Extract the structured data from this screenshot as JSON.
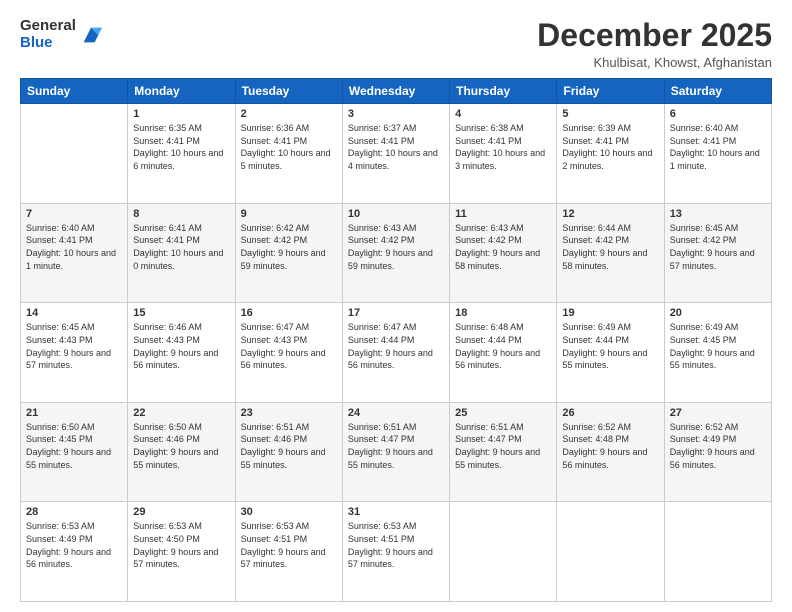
{
  "header": {
    "logo_general": "General",
    "logo_blue": "Blue",
    "month_title": "December 2025",
    "location": "Khulbisat, Khowst, Afghanistan"
  },
  "days_of_week": [
    "Sunday",
    "Monday",
    "Tuesday",
    "Wednesday",
    "Thursday",
    "Friday",
    "Saturday"
  ],
  "weeks": [
    [
      {
        "day": "",
        "sunrise": "",
        "sunset": "",
        "daylight": "",
        "empty": true
      },
      {
        "day": "1",
        "sunrise": "Sunrise: 6:35 AM",
        "sunset": "Sunset: 4:41 PM",
        "daylight": "Daylight: 10 hours and 6 minutes."
      },
      {
        "day": "2",
        "sunrise": "Sunrise: 6:36 AM",
        "sunset": "Sunset: 4:41 PM",
        "daylight": "Daylight: 10 hours and 5 minutes."
      },
      {
        "day": "3",
        "sunrise": "Sunrise: 6:37 AM",
        "sunset": "Sunset: 4:41 PM",
        "daylight": "Daylight: 10 hours and 4 minutes."
      },
      {
        "day": "4",
        "sunrise": "Sunrise: 6:38 AM",
        "sunset": "Sunset: 4:41 PM",
        "daylight": "Daylight: 10 hours and 3 minutes."
      },
      {
        "day": "5",
        "sunrise": "Sunrise: 6:39 AM",
        "sunset": "Sunset: 4:41 PM",
        "daylight": "Daylight: 10 hours and 2 minutes."
      },
      {
        "day": "6",
        "sunrise": "Sunrise: 6:40 AM",
        "sunset": "Sunset: 4:41 PM",
        "daylight": "Daylight: 10 hours and 1 minute."
      }
    ],
    [
      {
        "day": "7",
        "sunrise": "Sunrise: 6:40 AM",
        "sunset": "Sunset: 4:41 PM",
        "daylight": "Daylight: 10 hours and 1 minute."
      },
      {
        "day": "8",
        "sunrise": "Sunrise: 6:41 AM",
        "sunset": "Sunset: 4:41 PM",
        "daylight": "Daylight: 10 hours and 0 minutes."
      },
      {
        "day": "9",
        "sunrise": "Sunrise: 6:42 AM",
        "sunset": "Sunset: 4:42 PM",
        "daylight": "Daylight: 9 hours and 59 minutes."
      },
      {
        "day": "10",
        "sunrise": "Sunrise: 6:43 AM",
        "sunset": "Sunset: 4:42 PM",
        "daylight": "Daylight: 9 hours and 59 minutes."
      },
      {
        "day": "11",
        "sunrise": "Sunrise: 6:43 AM",
        "sunset": "Sunset: 4:42 PM",
        "daylight": "Daylight: 9 hours and 58 minutes."
      },
      {
        "day": "12",
        "sunrise": "Sunrise: 6:44 AM",
        "sunset": "Sunset: 4:42 PM",
        "daylight": "Daylight: 9 hours and 58 minutes."
      },
      {
        "day": "13",
        "sunrise": "Sunrise: 6:45 AM",
        "sunset": "Sunset: 4:42 PM",
        "daylight": "Daylight: 9 hours and 57 minutes."
      }
    ],
    [
      {
        "day": "14",
        "sunrise": "Sunrise: 6:45 AM",
        "sunset": "Sunset: 4:43 PM",
        "daylight": "Daylight: 9 hours and 57 minutes."
      },
      {
        "day": "15",
        "sunrise": "Sunrise: 6:46 AM",
        "sunset": "Sunset: 4:43 PM",
        "daylight": "Daylight: 9 hours and 56 minutes."
      },
      {
        "day": "16",
        "sunrise": "Sunrise: 6:47 AM",
        "sunset": "Sunset: 4:43 PM",
        "daylight": "Daylight: 9 hours and 56 minutes."
      },
      {
        "day": "17",
        "sunrise": "Sunrise: 6:47 AM",
        "sunset": "Sunset: 4:44 PM",
        "daylight": "Daylight: 9 hours and 56 minutes."
      },
      {
        "day": "18",
        "sunrise": "Sunrise: 6:48 AM",
        "sunset": "Sunset: 4:44 PM",
        "daylight": "Daylight: 9 hours and 56 minutes."
      },
      {
        "day": "19",
        "sunrise": "Sunrise: 6:49 AM",
        "sunset": "Sunset: 4:44 PM",
        "daylight": "Daylight: 9 hours and 55 minutes."
      },
      {
        "day": "20",
        "sunrise": "Sunrise: 6:49 AM",
        "sunset": "Sunset: 4:45 PM",
        "daylight": "Daylight: 9 hours and 55 minutes."
      }
    ],
    [
      {
        "day": "21",
        "sunrise": "Sunrise: 6:50 AM",
        "sunset": "Sunset: 4:45 PM",
        "daylight": "Daylight: 9 hours and 55 minutes."
      },
      {
        "day": "22",
        "sunrise": "Sunrise: 6:50 AM",
        "sunset": "Sunset: 4:46 PM",
        "daylight": "Daylight: 9 hours and 55 minutes."
      },
      {
        "day": "23",
        "sunrise": "Sunrise: 6:51 AM",
        "sunset": "Sunset: 4:46 PM",
        "daylight": "Daylight: 9 hours and 55 minutes."
      },
      {
        "day": "24",
        "sunrise": "Sunrise: 6:51 AM",
        "sunset": "Sunset: 4:47 PM",
        "daylight": "Daylight: 9 hours and 55 minutes."
      },
      {
        "day": "25",
        "sunrise": "Sunrise: 6:51 AM",
        "sunset": "Sunset: 4:47 PM",
        "daylight": "Daylight: 9 hours and 55 minutes."
      },
      {
        "day": "26",
        "sunrise": "Sunrise: 6:52 AM",
        "sunset": "Sunset: 4:48 PM",
        "daylight": "Daylight: 9 hours and 56 minutes."
      },
      {
        "day": "27",
        "sunrise": "Sunrise: 6:52 AM",
        "sunset": "Sunset: 4:49 PM",
        "daylight": "Daylight: 9 hours and 56 minutes."
      }
    ],
    [
      {
        "day": "28",
        "sunrise": "Sunrise: 6:53 AM",
        "sunset": "Sunset: 4:49 PM",
        "daylight": "Daylight: 9 hours and 56 minutes."
      },
      {
        "day": "29",
        "sunrise": "Sunrise: 6:53 AM",
        "sunset": "Sunset: 4:50 PM",
        "daylight": "Daylight: 9 hours and 57 minutes."
      },
      {
        "day": "30",
        "sunrise": "Sunrise: 6:53 AM",
        "sunset": "Sunset: 4:51 PM",
        "daylight": "Daylight: 9 hours and 57 minutes."
      },
      {
        "day": "31",
        "sunrise": "Sunrise: 6:53 AM",
        "sunset": "Sunset: 4:51 PM",
        "daylight": "Daylight: 9 hours and 57 minutes."
      },
      {
        "day": "",
        "sunrise": "",
        "sunset": "",
        "daylight": "",
        "empty": true
      },
      {
        "day": "",
        "sunrise": "",
        "sunset": "",
        "daylight": "",
        "empty": true
      },
      {
        "day": "",
        "sunrise": "",
        "sunset": "",
        "daylight": "",
        "empty": true
      }
    ]
  ]
}
